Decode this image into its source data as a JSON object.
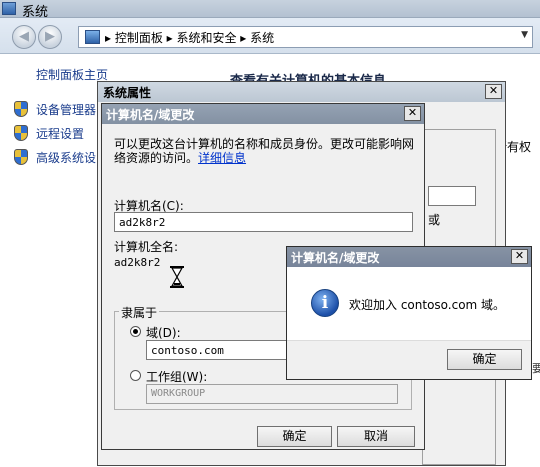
{
  "bg_window": {
    "title": "系统",
    "breadcrumbs": "▸ 控制面板 ▸ 系统和安全 ▸ 系统",
    "nav_back": "◀",
    "nav_forward": "▶",
    "dropdown": "▼",
    "sidebar": {
      "home": "控制面板主页",
      "items": [
        "设备管理器",
        "远程设置",
        "高级系统设"
      ]
    },
    "main_heading": "查看有关计算机的基本信息",
    "right_clip": "所有权"
  },
  "system_properties": {
    "title": "系统属性",
    "close": "✕",
    "fragment": "或",
    "right_stub": "要"
  },
  "domain_dialog": {
    "title": "计算机名/域更改",
    "close": "✕",
    "description": "可以更改这台计算机的名称和成员身份。更改可能影响网络资源的访问。",
    "link": "详细信息",
    "computer_name_label": "计算机名(C):",
    "computer_name_value": "ad2k8r2",
    "full_name_label": "计算机全名:",
    "full_name_value": "ad2k8r2",
    "member_of": "隶属于",
    "domain_label": "域(D):",
    "domain_value": "contoso.com",
    "workgroup_label": "工作组(W):",
    "workgroup_value": "WORKGROUP",
    "ok": "确定",
    "cancel": "取消"
  },
  "message_box": {
    "title": "计算机名/域更改",
    "close": "✕",
    "icon": "i",
    "message": "欢迎加入 contoso.com 域。",
    "ok": "确定"
  }
}
